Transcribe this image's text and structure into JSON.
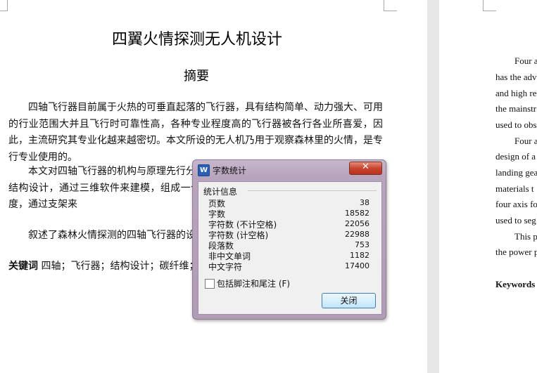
{
  "document": {
    "title": "四翼火情探测无人机设计",
    "abstract_heading": "摘要",
    "paragraphs": [
      "四轴飞行器目前属于火热的可垂直起落的飞行器，具有结构简单、动力强大、可用的行业范围大并且飞行时可靠性高，各种专业程度高的飞行器被各行各业所喜爱，因此，主流研究其专业化越来越密切。本文所设的无人机乃用于观察森林里的火情，是专行专业使用的。",
      "本文对四轴飞行器的机构与原理先行分析，对机架里的主板、力臂与起落架等机械结构设计，通过三维软件来建模，组成一个四轴飞行器，齿轮减速机构来细分转动角度，通过支架来",
      "叙述了森林火情探测的四轴飞行器的设"
    ],
    "keywords_label": "关键词",
    "keywords_text": "四轴；飞行器；结构设计；碳纤维；"
  },
  "right_page": {
    "lines": [
      "Four a",
      "has the adv",
      "and high re",
      "the mainstr",
      "used to obs",
      "Four a",
      "design of a",
      "landing gea",
      "materials t",
      "four axis fo",
      "used to seg",
      "This p",
      "the power p",
      "Keywords"
    ]
  },
  "dialog": {
    "title": "字数统计",
    "group_label": "统计信息",
    "stats": [
      {
        "label": "页数",
        "value": "38"
      },
      {
        "label": "字数",
        "value": "18582"
      },
      {
        "label": "字符数 (不计空格)",
        "value": "22056"
      },
      {
        "label": "字符数 (计空格)",
        "value": "22988"
      },
      {
        "label": "段落数",
        "value": "753"
      },
      {
        "label": "非中文单词",
        "value": "1182"
      },
      {
        "label": "中文字符",
        "value": "17400"
      }
    ],
    "checkbox_label": "包括脚注和尾注 (F)",
    "checkbox_checked": false,
    "close_button": "关闭",
    "app_icon": "W"
  }
}
